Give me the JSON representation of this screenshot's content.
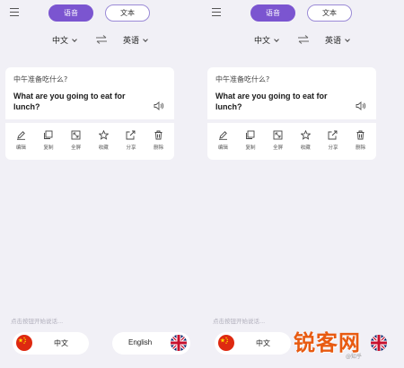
{
  "panels": [
    {
      "mode": {
        "voice_label": "语音",
        "text_label": "文本"
      },
      "languages": {
        "source": "中文",
        "target": "英语"
      },
      "card": {
        "source_text": "中午准备吃什么?",
        "translation": "What are you going to eat for lunch?"
      },
      "actions": [
        {
          "label": "编辑",
          "icon": "edit-icon"
        },
        {
          "label": "复制",
          "icon": "copy-icon"
        },
        {
          "label": "全屏",
          "icon": "fullscreen-icon"
        },
        {
          "label": "收藏",
          "icon": "star-icon"
        },
        {
          "label": "分享",
          "icon": "share-icon"
        },
        {
          "label": "删除",
          "icon": "trash-icon"
        }
      ],
      "hint": "点击按钮开始说话...",
      "lang_buttons": {
        "chinese": "中文",
        "english": "English"
      }
    },
    {
      "mode": {
        "voice_label": "语音",
        "text_label": "文本"
      },
      "languages": {
        "source": "中文",
        "target": "英语"
      },
      "card": {
        "source_text": "中午准备吃什么?",
        "translation": "What are you going to eat for lunch?"
      },
      "actions": [
        {
          "label": "编辑",
          "icon": "edit-icon"
        },
        {
          "label": "复制",
          "icon": "copy-icon"
        },
        {
          "label": "全屏",
          "icon": "fullscreen-icon"
        },
        {
          "label": "收藏",
          "icon": "star-icon"
        },
        {
          "label": "分享",
          "icon": "share-icon"
        },
        {
          "label": "删除",
          "icon": "trash-icon"
        }
      ],
      "hint": "点击按钮开始说话...",
      "lang_buttons": {
        "chinese": "中文"
      }
    }
  ],
  "watermark": {
    "text": "锐客网",
    "subtext": "@知乎"
  },
  "colors": {
    "accent": "#7b55d0",
    "background": "#f1f0f6",
    "watermark": "#e85a10"
  }
}
